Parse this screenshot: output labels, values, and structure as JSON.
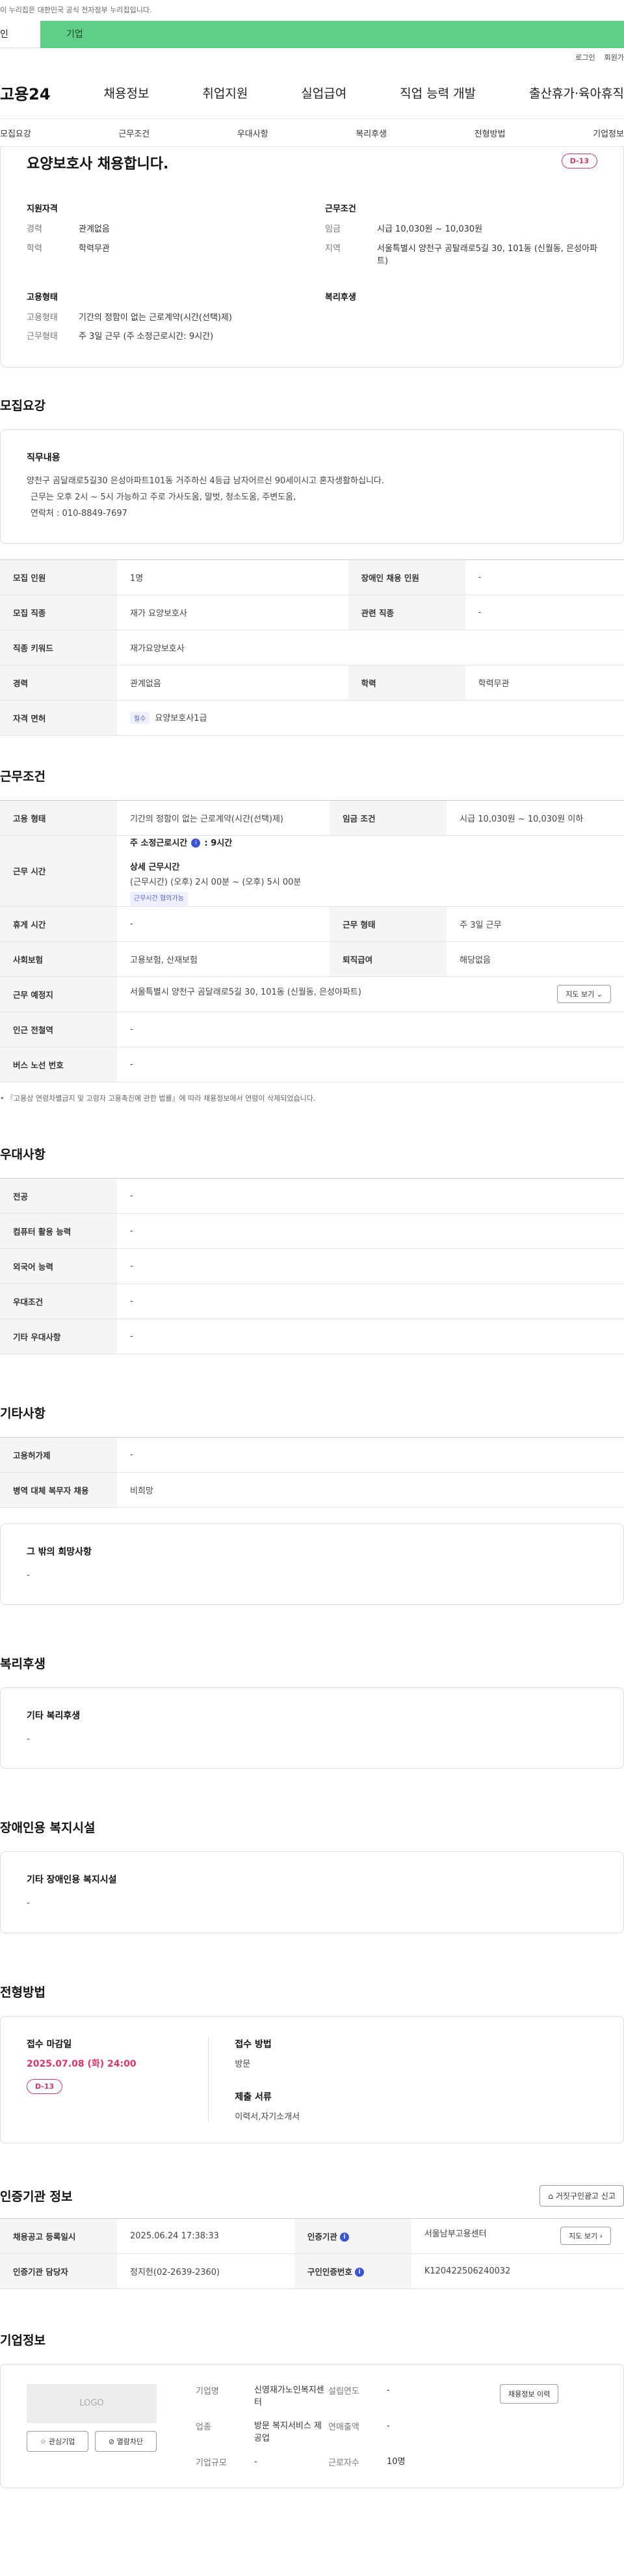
{
  "gov_notice": "이 누리집은 대한민국 공식 전자정부 누리집입니다.",
  "top_tabs": [
    "인",
    "기업"
  ],
  "util": [
    "로그인",
    "회원가"
  ],
  "logo": "고용24",
  "gnb": [
    "채용정보",
    "취업지원",
    "실업급여",
    "직업 능력 개발",
    "출산휴가·육아휴직"
  ],
  "subnav": [
    "모집요강",
    "근무조건",
    "우대사항",
    "복리후생",
    "전형방법",
    "기업정보"
  ],
  "header": {
    "title": "요양보호사 채용합니다.",
    "dday": "D-13",
    "qual_title": "지원자격",
    "qual": [
      {
        "k": "경력",
        "v": "관계없음"
      },
      {
        "k": "학력",
        "v": "학력무관"
      }
    ],
    "cond_title": "근무조건",
    "cond": [
      {
        "k": "임금",
        "v": "시급 10,030원 ~ 10,030원"
      },
      {
        "k": "지역",
        "v": "서울특별시 양천구 공탈래로5길 30, 101동 (신월동, 은성아파트)"
      }
    ],
    "emp_title": "고용형태",
    "emp": [
      {
        "k": "고용형태",
        "v": "기간의 정함이 없는 근로계약(시간(선택)제)"
      },
      {
        "k": "근무형태",
        "v": "주 3일 근무 (주 소정근로시간: 9시간)"
      }
    ],
    "welfare_title": "복리후생"
  },
  "recruit": {
    "section": "모집요강",
    "box_title": "직무내용",
    "lines": [
      "양천구 곰달래로5길30 은성아파트101동 거주하신 4등급 남자어르신 90세이시고 혼자생활하십니다.",
      "근무는 오후 2시 ~ 5시 가능하고 주로 가사도움, 말벗, 청소도움, 주변도움,",
      "연락처 : 010-8849-7697"
    ],
    "rows": [
      {
        "k1": "모집 인원",
        "v1": "1명",
        "k2": "장애인 채용 인원",
        "v2": "-"
      },
      {
        "k1": "모집 직종",
        "v1": "재가 요양보호사",
        "k2": "관련 직종",
        "v2": "-"
      },
      {
        "k1": "직종 키워드",
        "v1": "재가요양보호사"
      },
      {
        "k1": "경력",
        "v1": "관계없음",
        "k2": "학력",
        "v2": "학력무관"
      },
      {
        "k1": "자격 면허",
        "tag": "필수",
        "v1": "요양보호사1급"
      }
    ]
  },
  "work": {
    "section": "근무조건",
    "r1": {
      "k1": "고용 형태",
      "v1": "기간의 정함이 없는 근로계약(시간(선택)제)",
      "k2": "임금 조건",
      "v2": "시급 10,030원 ~ 10,030원 이하"
    },
    "time_label": "근무 시간",
    "weekly": "주 소정근로시간",
    "weekly_v": ": 9시간",
    "detail": "상세 근무시간",
    "detail_v": "(근무시간) (오후) 2시 00분 ~ (오후) 5시 00분",
    "chip": "근무시간 협의가능",
    "r3": {
      "k1": "휴게 시간",
      "v1": "-",
      "k2": "근무 형태",
      "v2": "주 3일 근무"
    },
    "r4": {
      "k1": "사회보험",
      "v1": "고용보험, 산재보험",
      "k2": "퇴직급여",
      "v2": "해당없음"
    },
    "r5": {
      "k1": "근무 예정지",
      "v1": "서울특별시 양천구 곰달래로5길 30, 101동 (신월동, 은성아파트)",
      "btn": "지도 보기 ⌄"
    },
    "r6": {
      "k1": "인근 전철역",
      "v1": "-"
    },
    "r7": {
      "k1": "버스 노선 번호",
      "v1": "-"
    },
    "note": "• 『고용상 연령차별금지 및 고령자 고용촉진에 관한 법률』에 따라 채용정보에서 연령이 삭제되었습니다."
  },
  "pref": {
    "section": "우대사항",
    "rows": [
      {
        "k": "전공",
        "v": "-"
      },
      {
        "k": "컴퓨터 활용 능력",
        "v": "-"
      },
      {
        "k": "외국어 능력",
        "v": "-"
      },
      {
        "k": "우대조건",
        "v": "-"
      },
      {
        "k": "기타 우대사항",
        "v": "-"
      }
    ]
  },
  "etc": {
    "section": "기타사항",
    "rows": [
      {
        "k": "고용허가제",
        "v": "-"
      },
      {
        "k": "병역 대체 복무자 채용",
        "v": "비희망"
      }
    ],
    "box_title": "그 밖의 희망사항",
    "box_v": "-"
  },
  "welfare": {
    "section": "복리후생",
    "box_title": "기타 복리후생",
    "box_v": "-"
  },
  "disab": {
    "section": "장애인용 복지시설",
    "box_title": "기타 장애인용 복지시설",
    "box_v": "-"
  },
  "process": {
    "section": "전형방법",
    "deadline_t": "접수 마감일",
    "deadline_v": "2025.07.08 (화) 24:00",
    "dday": "D-13",
    "method_t": "접수 방법",
    "method_v": "방문",
    "docs_t": "제출 서류",
    "docs_v": "이력서,자기소개서"
  },
  "agency": {
    "section": "인증기관 정보",
    "report": "거짓구인광고 신고",
    "r1": {
      "k1": "채용공고 등록일시",
      "v1": "2025.06.24 17:38:33",
      "k2": "인증기관",
      "v2": "서울남부고용센터",
      "btn": "지도 보기 ›"
    },
    "r2": {
      "k1": "인증기관 담당자",
      "v1": "정지헌(02-2639-2360)",
      "k2": "구인인증번호",
      "v2": "K120422506240032"
    }
  },
  "company": {
    "section": "기업정보",
    "logo": "LOGO",
    "fav": "☆ 관심기업",
    "block": "⊘ 열람차단",
    "name_k": "기업명",
    "name_v": "신영재가노인복지센터",
    "year_k": "설립연도",
    "year_v": "-",
    "ind_k": "업종",
    "ind_v": "방문 복지서비스 제공업",
    "sales_k": "연매출액",
    "sales_v": "-",
    "emp_k": "근로자수",
    "emp_v": "10명",
    "size_k": "기업규모",
    "size_v": "-",
    "btn": "채용정보 이력"
  }
}
